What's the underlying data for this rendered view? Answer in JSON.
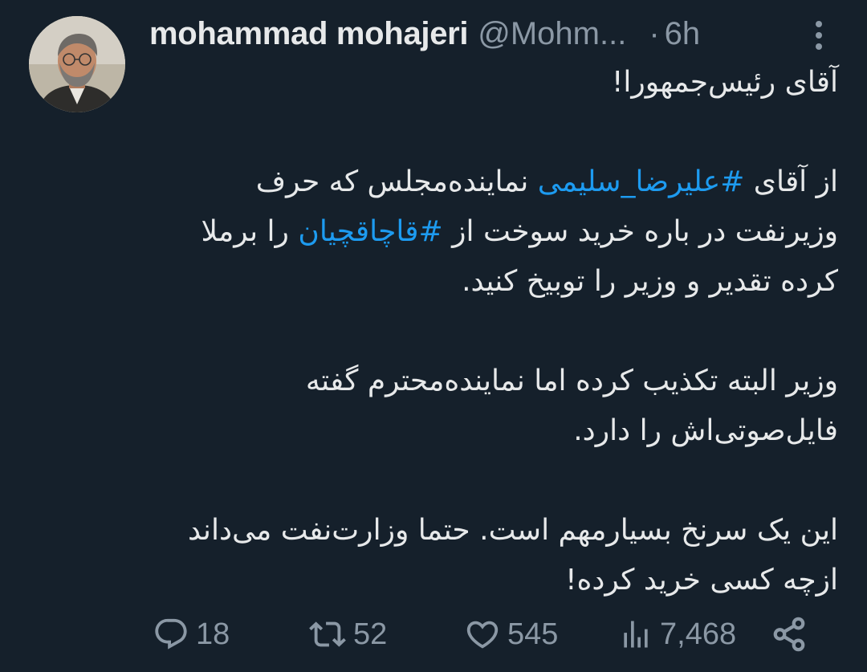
{
  "author": {
    "display_name": "mohammad mohajeri",
    "handle": "@Mohm...",
    "separator": "·",
    "time": "6h"
  },
  "tweet": {
    "p1": "آقای رئیس‌جمهورا!",
    "p2_part1": "از آقای ",
    "p2_hashtag1": "#علیرضا_سلیمی",
    "p2_part2": " نماینده‌مجلس که حرف وزیرنفت در باره خرید سوخت از ",
    "p2_hashtag2": "#قاچاقچیان",
    "p2_part3": " را برملا کرده تقدیر و وزیر را توبیخ کنید.",
    "p3": "وزیر البته تکذیب کرده اما نماینده‌محترم گفته فایل‌صوتی‌اش را دارد.",
    "p4": "این یک سرنخ بسیارمهم است. حتما وزارت‌نفت می‌داند ازچه کسی خرید کرده!"
  },
  "actions": {
    "replies": "18",
    "retweets": "52",
    "likes": "545",
    "views": "7,468"
  },
  "icons": {
    "more": "more-vertical-icon",
    "reply": "reply-icon",
    "retweet": "retweet-icon",
    "like": "heart-icon",
    "views": "analytics-icon",
    "share": "share-icon"
  },
  "colors": {
    "background": "#15202b",
    "text": "#e7e9ea",
    "secondary": "#8b98a5",
    "link": "#1d9bf0"
  }
}
